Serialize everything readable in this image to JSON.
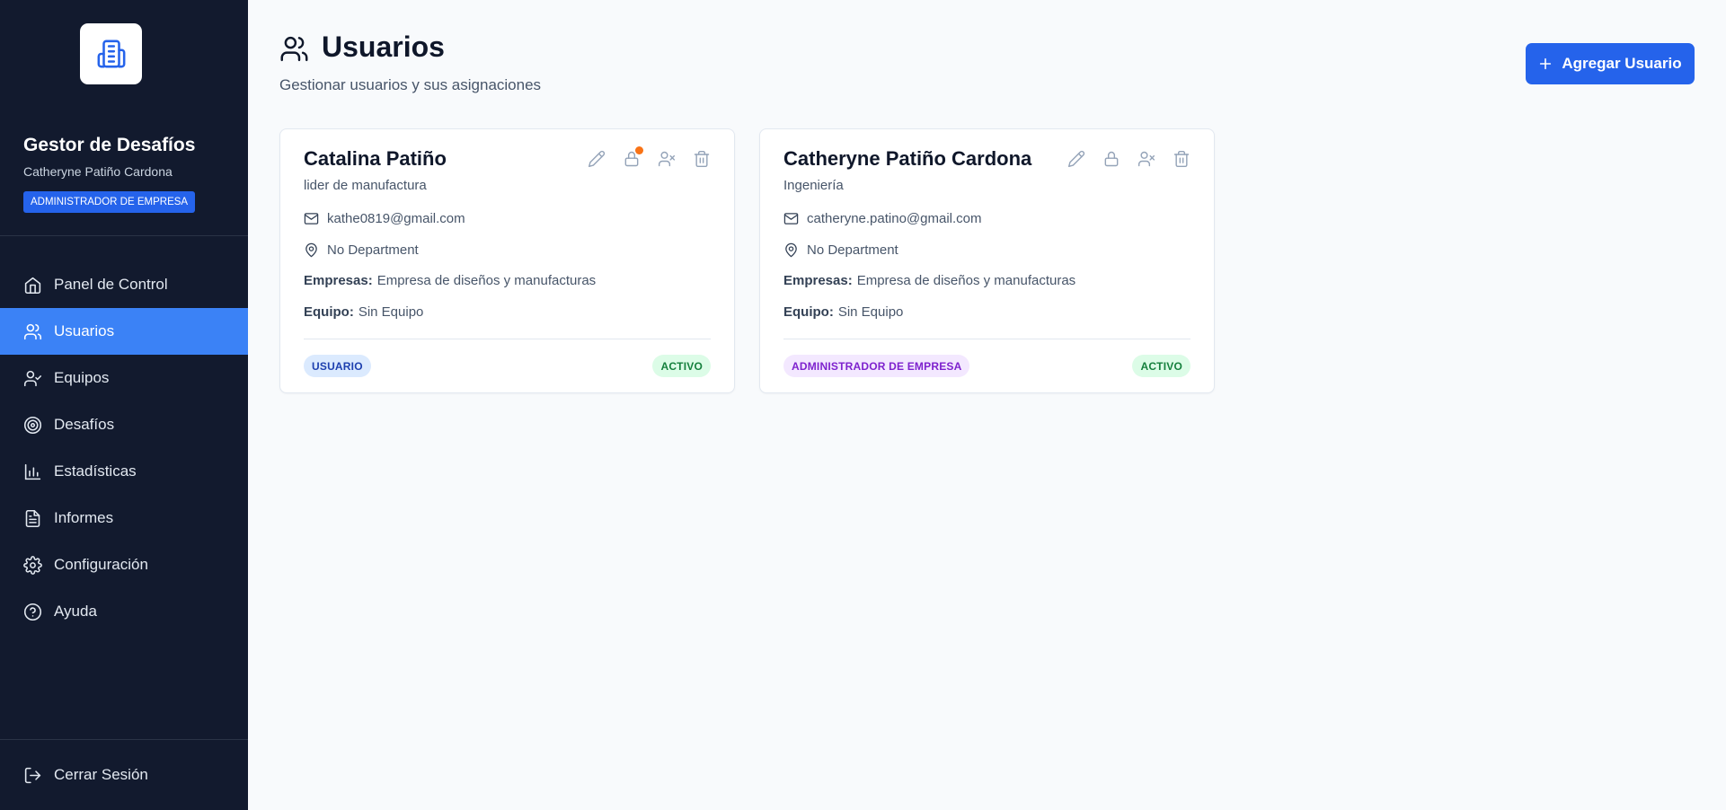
{
  "sidebar": {
    "app_title": "Gestor de Desafíos",
    "user_name": "Catheryne Patiño Cardona",
    "user_role": "ADMINISTRADOR DE EMPRESA",
    "items": [
      {
        "label": "Panel de Control",
        "icon": "home-icon"
      },
      {
        "label": "Usuarios",
        "icon": "users-icon",
        "active": true
      },
      {
        "label": "Equipos",
        "icon": "user-check-icon"
      },
      {
        "label": "Desafíos",
        "icon": "target-icon"
      },
      {
        "label": "Estadísticas",
        "icon": "bar-chart-icon"
      },
      {
        "label": "Informes",
        "icon": "file-text-icon"
      },
      {
        "label": "Configuración",
        "icon": "gear-icon"
      },
      {
        "label": "Ayuda",
        "icon": "help-circle-icon"
      }
    ],
    "logout_label": "Cerrar Sesión"
  },
  "header": {
    "title": "Usuarios",
    "subtitle": "Gestionar usuarios y sus asignaciones",
    "add_button_label": "Agregar Usuario"
  },
  "labels": {
    "companies": "Empresas:",
    "team": "Equipo:"
  },
  "users": [
    {
      "name": "Catalina Patiño",
      "position": "lider de manufactura",
      "email": "kathe0819@gmail.com",
      "department": "No Department",
      "companies": "Empresa de diseños y manufacturas",
      "team": "Sin Equipo",
      "role_badge": "USUARIO",
      "status_badge": "ACTIVO"
    },
    {
      "name": "Catheryne Patiño Cardona",
      "position": "Ingeniería",
      "email": "catheryne.patino@gmail.com",
      "department": "No Department",
      "companies": "Empresa de diseños y manufacturas",
      "team": "Sin Equipo",
      "role_badge": "ADMINISTRADOR DE EMPRESA",
      "status_badge": "ACTIVO"
    }
  ],
  "colors": {
    "sidebar_bg": "#121a2e",
    "accent": "#2563eb",
    "active_nav": "#3b82f6",
    "status_green": "#15803d",
    "notification": "#f97316"
  }
}
